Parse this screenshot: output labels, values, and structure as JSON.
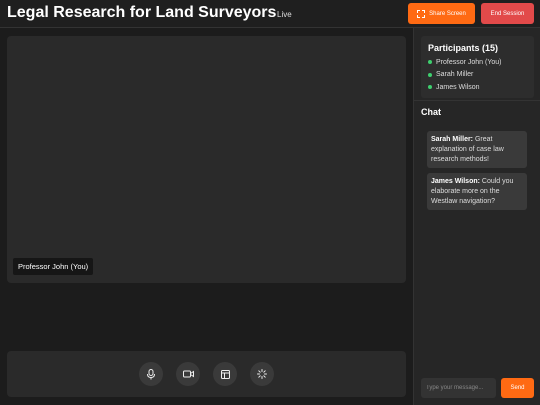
{
  "header": {
    "title": "Legal Research for Land Surveyors",
    "status": "Live",
    "share_label": "Share Screen",
    "end_label": "End Session"
  },
  "video": {
    "name_tag": "Professor John (You)"
  },
  "controls": {
    "icons": [
      "microphone-icon",
      "camera-icon",
      "layout-icon",
      "loading-icon"
    ]
  },
  "participants": {
    "title": "Participants (15)",
    "items": [
      {
        "name": "Professor John (You)",
        "status": "online"
      },
      {
        "name": "Sarah Miller",
        "status": "online"
      },
      {
        "name": "James Wilson",
        "status": "online"
      }
    ]
  },
  "chat": {
    "title": "Chat",
    "messages": [
      {
        "author": "Sarah Miller:",
        "text": "Great explanation of case law research methods!"
      },
      {
        "author": "James Wilson:",
        "text": "Could you elaborate more on the Westlaw navigation?"
      }
    ],
    "input_placeholder": "Type your message...",
    "send_label": "Send"
  },
  "colors": {
    "accent": "#ff6a13",
    "danger": "#e24a4a",
    "online": "#3ecf6e"
  }
}
